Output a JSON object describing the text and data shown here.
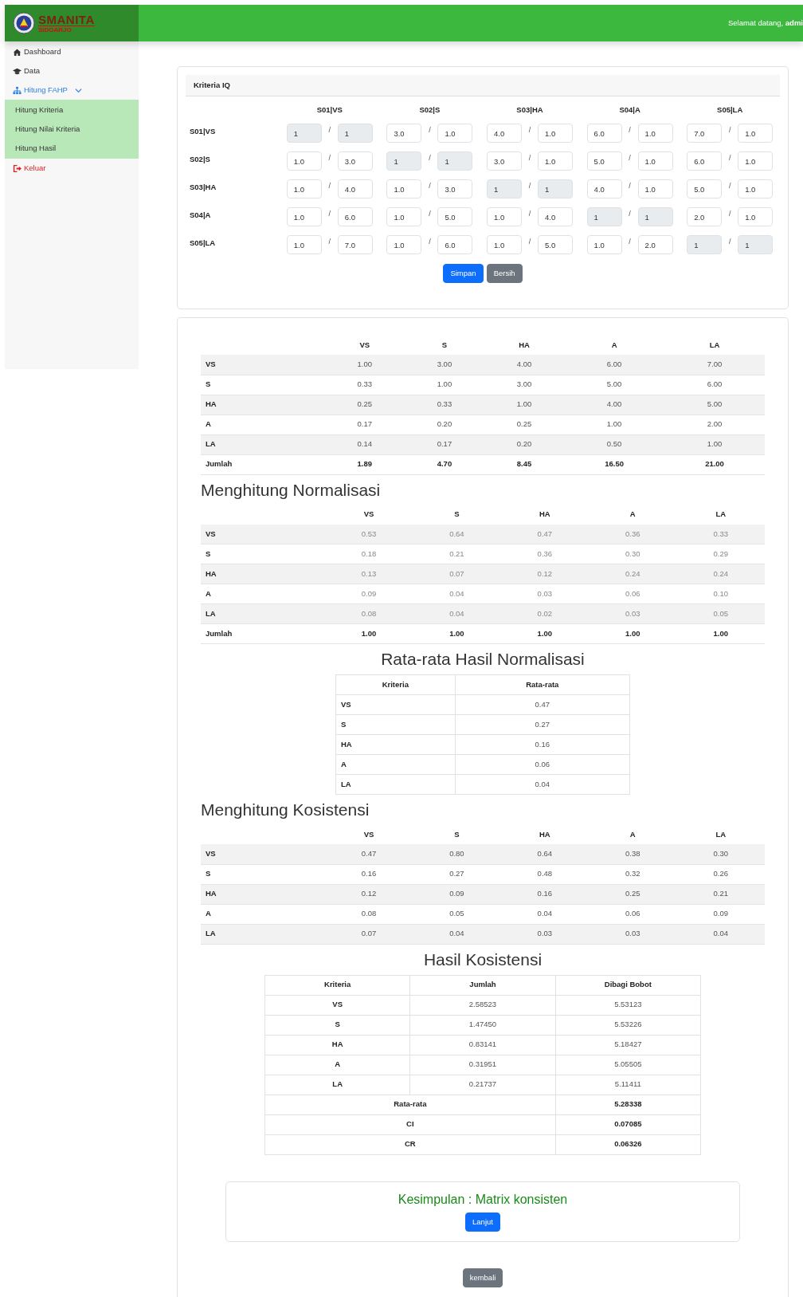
{
  "brand": {
    "name": "SMANITA",
    "subtitle": "SIDOARJO"
  },
  "header": {
    "greeting": "Selamat datang, **admi**"
  },
  "sidebar": {
    "items": [
      {
        "label": "Dashboard",
        "kind": "link"
      },
      {
        "label": "Data",
        "kind": "link"
      },
      {
        "label": "Hitung FAHP",
        "kind": "group",
        "expanded": true,
        "children": [
          {
            "label": "Hitung Kriteria"
          },
          {
            "label": "Hitung Nilai Kriteria"
          },
          {
            "label": "Hitung Hasil"
          }
        ]
      },
      {
        "label": "Keluar",
        "kind": "logout"
      }
    ]
  },
  "criteria_form": {
    "title": "Kriteria IQ",
    "columns": [
      "S01|VS",
      "S02|S",
      "S03|HA",
      "S04|A",
      "S05|LA"
    ],
    "rows": [
      {
        "label": "S01|VS",
        "cells": [
          {
            "num": "1",
            "sep": "/",
            "den": "1",
            "disabled": true
          },
          {
            "num": "3.0",
            "sep": "/",
            "den": "1.0",
            "disabled": false
          },
          {
            "num": "4.0",
            "sep": "/",
            "den": "1.0",
            "disabled": false
          },
          {
            "num": "6.0",
            "sep": "/",
            "den": "1.0",
            "disabled": false
          },
          {
            "num": "7.0",
            "sep": "/",
            "den": "1.0",
            "disabled": false
          }
        ]
      },
      {
        "label": "S02|S",
        "cells": [
          {
            "num": "1.0",
            "sep": "/",
            "den": "3.0",
            "disabled": false
          },
          {
            "num": "1",
            "sep": "/",
            "den": "1",
            "disabled": true
          },
          {
            "num": "3.0",
            "sep": "/",
            "den": "1.0",
            "disabled": false
          },
          {
            "num": "5.0",
            "sep": "/",
            "den": "1.0",
            "disabled": false
          },
          {
            "num": "6.0",
            "sep": "/",
            "den": "1.0",
            "disabled": false
          }
        ]
      },
      {
        "label": "S03|HA",
        "cells": [
          {
            "num": "1.0",
            "sep": "/",
            "den": "4.0",
            "disabled": false
          },
          {
            "num": "1.0",
            "sep": "/",
            "den": "3.0",
            "disabled": false
          },
          {
            "num": "1",
            "sep": "/",
            "den": "1",
            "disabled": true
          },
          {
            "num": "4.0",
            "sep": "/",
            "den": "1.0",
            "disabled": false
          },
          {
            "num": "5.0",
            "sep": "/",
            "den": "1.0",
            "disabled": false
          }
        ]
      },
      {
        "label": "S04|A",
        "cells": [
          {
            "num": "1.0",
            "sep": "/",
            "den": "6.0",
            "disabled": false
          },
          {
            "num": "1.0",
            "sep": "/",
            "den": "5.0",
            "disabled": false
          },
          {
            "num": "1.0",
            "sep": "/",
            "den": "4.0",
            "disabled": false
          },
          {
            "num": "1",
            "sep": "/",
            "den": "1",
            "disabled": true
          },
          {
            "num": "2.0",
            "sep": "/",
            "den": "1.0",
            "disabled": false
          }
        ]
      },
      {
        "label": "S05|LA",
        "cells": [
          {
            "num": "1.0",
            "sep": "/",
            "den": "7.0",
            "disabled": false
          },
          {
            "num": "1.0",
            "sep": "/",
            "den": "6.0",
            "disabled": false
          },
          {
            "num": "1.0",
            "sep": "/",
            "den": "5.0",
            "disabled": false
          },
          {
            "num": "1.0",
            "sep": "/",
            "den": "2.0",
            "disabled": false
          },
          {
            "num": "1",
            "sep": "/",
            "den": "1",
            "disabled": true
          }
        ]
      }
    ],
    "buttons": [
      {
        "label": "Simpan",
        "kind": "primary"
      },
      {
        "label": "Bersih",
        "kind": "secondary"
      }
    ]
  },
  "pairwise_table": {
    "columns": [
      "VS",
      "S",
      "HA",
      "A",
      "LA"
    ],
    "rows": [
      {
        "label": "VS",
        "values": [
          "1.00",
          "3.00",
          "4.00",
          "6.00",
          "7.00"
        ]
      },
      {
        "label": "S",
        "values": [
          "0.33",
          "1.00",
          "3.00",
          "5.00",
          "6.00"
        ]
      },
      {
        "label": "HA",
        "values": [
          "0.25",
          "0.33",
          "1.00",
          "4.00",
          "5.00"
        ]
      },
      {
        "label": "A",
        "values": [
          "0.17",
          "0.20",
          "0.25",
          "1.00",
          "2.00"
        ]
      },
      {
        "label": "LA",
        "values": [
          "0.14",
          "0.17",
          "0.20",
          "0.50",
          "1.00"
        ]
      }
    ],
    "total": {
      "label": "Jumlah",
      "values": [
        "1.89",
        "4.70",
        "8.45",
        "16.50",
        "21.00"
      ]
    }
  },
  "normalization": {
    "title": "Menghitung Normalisasi",
    "columns": [
      "VS",
      "S",
      "HA",
      "A",
      "LA"
    ],
    "rows": [
      {
        "label": "VS",
        "values": [
          "0.53",
          "0.64",
          "0.47",
          "0.36",
          "0.33"
        ]
      },
      {
        "label": "S",
        "values": [
          "0.18",
          "0.21",
          "0.36",
          "0.30",
          "0.29"
        ]
      },
      {
        "label": "HA",
        "values": [
          "0.13",
          "0.07",
          "0.12",
          "0.24",
          "0.24"
        ]
      },
      {
        "label": "A",
        "values": [
          "0.09",
          "0.04",
          "0.03",
          "0.06",
          "0.10"
        ]
      },
      {
        "label": "LA",
        "values": [
          "0.08",
          "0.04",
          "0.02",
          "0.03",
          "0.05"
        ]
      }
    ],
    "total": {
      "label": "Jumlah",
      "values": [
        "1.00",
        "1.00",
        "1.00",
        "1.00",
        "1.00"
      ]
    }
  },
  "average": {
    "title": "Rata-rata Hasil Normalisasi",
    "columns": [
      "Kriteria",
      "Rata-rata"
    ],
    "rows": [
      {
        "label": "VS",
        "value": "0.47"
      },
      {
        "label": "S",
        "value": "0.27"
      },
      {
        "label": "HA",
        "value": "0.16"
      },
      {
        "label": "A",
        "value": "0.06"
      },
      {
        "label": "LA",
        "value": "0.04"
      }
    ]
  },
  "consistency": {
    "title": "Menghitung Kosistensi",
    "columns": [
      "VS",
      "S",
      "HA",
      "A",
      "LA"
    ],
    "rows": [
      {
        "label": "VS",
        "values": [
          "0.47",
          "0.80",
          "0.64",
          "0.38",
          "0.30"
        ]
      },
      {
        "label": "S",
        "values": [
          "0.16",
          "0.27",
          "0.48",
          "0.32",
          "0.26"
        ]
      },
      {
        "label": "HA",
        "values": [
          "0.12",
          "0.09",
          "0.16",
          "0.25",
          "0.21"
        ]
      },
      {
        "label": "A",
        "values": [
          "0.08",
          "0.05",
          "0.04",
          "0.06",
          "0.09"
        ]
      },
      {
        "label": "LA",
        "values": [
          "0.07",
          "0.04",
          "0.03",
          "0.03",
          "0.04"
        ]
      }
    ]
  },
  "consistency_result": {
    "title": "Hasil Kosistensi",
    "columns": [
      "Kriteria",
      "Jumlah",
      "Dibagi Bobot"
    ],
    "rows": [
      {
        "label": "VS",
        "sum": "2.58523",
        "weighted": "5.53123"
      },
      {
        "label": "S",
        "sum": "1.47450",
        "weighted": "5.53226"
      },
      {
        "label": "HA",
        "sum": "0.83141",
        "weighted": "5.18427"
      },
      {
        "label": "A",
        "sum": "0.31951",
        "weighted": "5.05505"
      },
      {
        "label": "LA",
        "sum": "0.21737",
        "weighted": "5.11411"
      }
    ],
    "summary": [
      {
        "label": "Rata-rata",
        "value": "5.28338"
      },
      {
        "label": "CI",
        "value": "0.07085"
      },
      {
        "label": "CR",
        "value": "0.06326"
      }
    ]
  },
  "conclusion": {
    "text": "Kesimpulan : Matrix konsisten",
    "button": "Lanjut"
  },
  "back_button": "kembali"
}
